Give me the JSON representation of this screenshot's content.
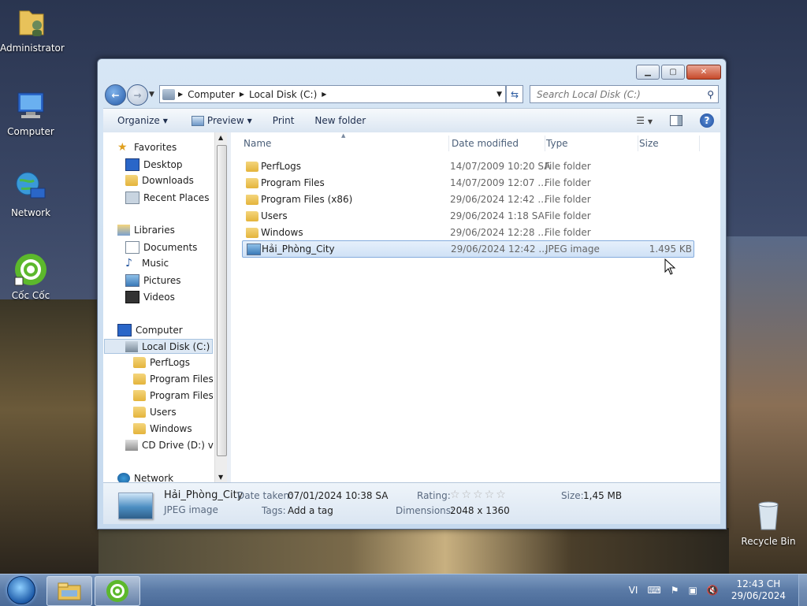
{
  "desktop": {
    "icons": [
      {
        "label": "Administrator",
        "icon": "user-folder-icon"
      },
      {
        "label": "Computer",
        "icon": "computer-icon"
      },
      {
        "label": "Network",
        "icon": "network-icon"
      },
      {
        "label": "Cốc Cốc",
        "icon": "coccoc-browser-icon"
      },
      {
        "label": "Recycle Bin",
        "icon": "recycle-bin-icon"
      }
    ]
  },
  "window": {
    "address": {
      "crumbs": [
        "Computer",
        "Local Disk (C:)"
      ]
    },
    "search_placeholder": "Search Local Disk (C:)",
    "toolbar": {
      "organize": "Organize",
      "preview": "Preview",
      "print": "Print",
      "new_folder": "New folder"
    },
    "navpane": {
      "favorites": "Favorites",
      "desktop": "Desktop",
      "downloads": "Downloads",
      "recent": "Recent Places",
      "libraries": "Libraries",
      "documents": "Documents",
      "music": "Music",
      "pictures": "Pictures",
      "videos": "Videos",
      "computer": "Computer",
      "local_disk": "Local Disk (C:)",
      "perflogs": "PerfLogs",
      "program_files": "Program Files",
      "program_files_x86": "Program Files (",
      "users": "Users",
      "windows": "Windows",
      "cd_drive": "CD Drive (D:) virt",
      "network": "Network"
    },
    "columns": {
      "name": "Name",
      "date": "Date modified",
      "type": "Type",
      "size": "Size"
    },
    "files": [
      {
        "name": "PerfLogs",
        "date": "14/07/2009 10:20 SA",
        "type": "File folder",
        "size": ""
      },
      {
        "name": "Program Files",
        "date": "14/07/2009 12:07 ...",
        "type": "File folder",
        "size": ""
      },
      {
        "name": "Program Files (x86)",
        "date": "29/06/2024 12:42 ...",
        "type": "File folder",
        "size": ""
      },
      {
        "name": "Users",
        "date": "29/06/2024 1:18 SA",
        "type": "File folder",
        "size": ""
      },
      {
        "name": "Windows",
        "date": "29/06/2024 12:28 ...",
        "type": "File folder",
        "size": ""
      },
      {
        "name": "Hải_Phòng_City",
        "date": "29/06/2024 12:42 ...",
        "type": "JPEG image",
        "size": "1.495 KB"
      }
    ],
    "details": {
      "name": "Hải_Phòng_City",
      "type": "JPEG image",
      "date_taken_label": "Date taken:",
      "date_taken": "07/01/2024 10:38 SA",
      "tags_label": "Tags:",
      "tags": "Add a tag",
      "rating_label": "Rating:",
      "rating_value": 0,
      "dimensions_label": "Dimensions:",
      "dimensions": "2048 x 1360",
      "size_label": "Size:",
      "size": "1,45 MB"
    }
  },
  "taskbar": {
    "language": "VI",
    "time": "12:43 CH",
    "date": "29/06/2024"
  }
}
